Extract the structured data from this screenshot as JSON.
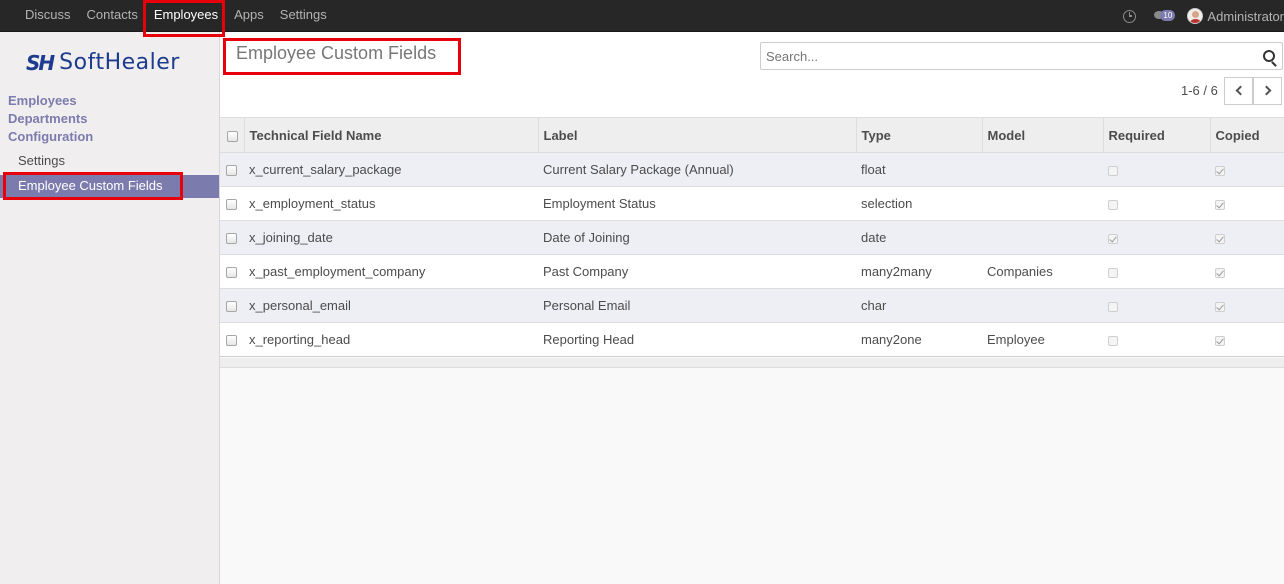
{
  "topnav": {
    "items": [
      {
        "label": "Discuss"
      },
      {
        "label": "Contacts"
      },
      {
        "label": "Employees",
        "active": true
      },
      {
        "label": "Apps"
      },
      {
        "label": "Settings"
      }
    ],
    "message_count": "10",
    "username": "Administrator"
  },
  "logo": {
    "mark": "SH",
    "text": "SoftHealer",
    "brand_color": "#1d3b8f"
  },
  "sidebar": {
    "sections": [
      "Employees",
      "Departments",
      "Configuration"
    ],
    "sub_items": [
      "Settings"
    ],
    "active_item": "Employee Custom Fields",
    "accent_color": "#7c7bad"
  },
  "main": {
    "title": "Employee Custom Fields",
    "search_placeholder": "Search...",
    "pager": "1-6 / 6"
  },
  "table": {
    "columns": [
      "Technical Field Name",
      "Label",
      "Type",
      "Model",
      "Required",
      "Copied"
    ],
    "rows": [
      {
        "name": "x_current_salary_package",
        "label": "Current Salary Package (Annual)",
        "type": "float",
        "model": "",
        "required": false,
        "copied": true
      },
      {
        "name": "x_employment_status",
        "label": "Employment Status",
        "type": "selection",
        "model": "",
        "required": false,
        "copied": true
      },
      {
        "name": "x_joining_date",
        "label": "Date of Joining",
        "type": "date",
        "model": "",
        "required": true,
        "copied": true
      },
      {
        "name": "x_past_employment_company",
        "label": "Past Company",
        "type": "many2many",
        "model": "Companies",
        "required": false,
        "copied": true
      },
      {
        "name": "x_personal_email",
        "label": "Personal Email",
        "type": "char",
        "model": "",
        "required": false,
        "copied": true
      },
      {
        "name": "x_reporting_head",
        "label": "Reporting Head",
        "type": "many2one",
        "model": "Employee",
        "required": false,
        "copied": true
      }
    ]
  },
  "highlight_color": "#e8000b"
}
